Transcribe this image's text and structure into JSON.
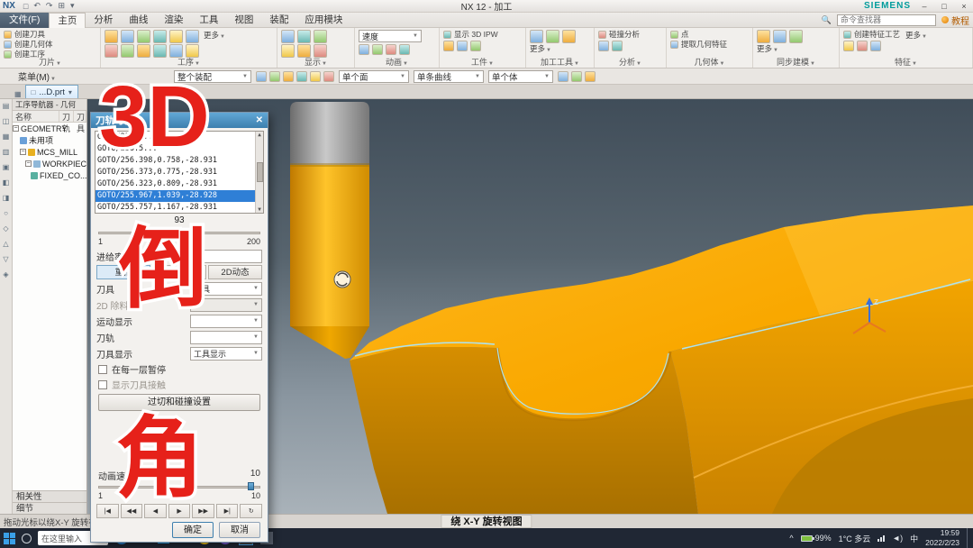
{
  "window": {
    "logo": "NX",
    "title": "NX 12 - 加工",
    "brand": "SIEMENS",
    "min": "–",
    "max": "□",
    "close": "×"
  },
  "menu": {
    "file": "文件(F)",
    "tabs": [
      "主页",
      "分析",
      "曲线",
      "渲染",
      "工具",
      "视图",
      "装配",
      "应用模块"
    ],
    "finder_placeholder": "命令查找器",
    "tutorial": "教程"
  },
  "ribbon": {
    "groups": [
      {
        "label": "刀片",
        "items": [
          "创建刀具",
          "创建几何体",
          "创建工序"
        ]
      },
      {
        "label": "工序",
        "more": "更多"
      },
      {
        "label": "显示"
      },
      {
        "label": "动画",
        "speed_label": "速度"
      },
      {
        "label": "工件",
        "ipw_label": "显示 3D IPW"
      },
      {
        "label": "加工工具",
        "more": "更多"
      },
      {
        "label": "分析",
        "item": "碰撞分析"
      },
      {
        "label": "几何体",
        "items": [
          "点",
          "提取几何特征"
        ]
      },
      {
        "label": "同步建模",
        "more": "更多"
      },
      {
        "label": "特征",
        "item": "创建特征工艺",
        "more": "更多"
      }
    ]
  },
  "selbar": {
    "menu_label": "菜单(M)",
    "scope_value": "整个装配",
    "filters": [
      "单个面",
      "单条曲线",
      "单个体"
    ]
  },
  "tabstrip": {
    "doc": "...D.prt"
  },
  "navigator": {
    "title": "工序导航器 - 几何",
    "columns": [
      "名称",
      "刀轨",
      "刀具"
    ],
    "tree": [
      {
        "label": "GEOMETRY"
      },
      {
        "label": "未用项"
      },
      {
        "label": "MCS_MILL"
      },
      {
        "label": "WORKPIECE"
      },
      {
        "label": "FIXED_CO..."
      }
    ],
    "sections": [
      "相关性",
      "细节"
    ]
  },
  "dialog": {
    "title": "刀轨可视化",
    "goto_lines": [
      "GOTO/256.6...",
      "GOTO/256.5...",
      "GOTO/256.398,0.758,-28.931",
      "GOTO/256.373,0.775,-28.931",
      "GOTO/256.323,0.809,-28.931",
      "GOTO/255.967,1.039,-28.928",
      "GOTO/255.757,1.167,-28.931"
    ],
    "progress": {
      "value": "93",
      "min": "1",
      "max": "200"
    },
    "feed_label": "进给率",
    "tabs": [
      "重播",
      "3D动态",
      "2D动态"
    ],
    "fields": [
      {
        "label": "刀具",
        "value": "刀具"
      },
      {
        "label": "2D 除料",
        "value": ""
      },
      {
        "label": "运动显示",
        "value": ""
      },
      {
        "label": "刀轨",
        "value": ""
      },
      {
        "label": "刀具显示",
        "value": "工具显示"
      }
    ],
    "checkbox1": "在每一层暂停",
    "checkbox2": "显示刀具接触",
    "gouge_button": "过切和碰撞设置",
    "anim": {
      "label": "动画速度",
      "value": "10",
      "min": "1",
      "max": "10"
    },
    "playback": [
      "|◀",
      "◀◀",
      "◀",
      "▶",
      "▶▶",
      "▶|",
      "↻"
    ],
    "ok": "确定",
    "cancel": "取消"
  },
  "viewport": {
    "rotate_label": "绕 X-Y 旋转视图"
  },
  "statusbar": {
    "prompt": "拖动光标以绕X-Y 旋转视图"
  },
  "taskbar": {
    "search_placeholder": "在这里输入",
    "nx": "NX",
    "tray": {
      "battery": "99%",
      "weather": "1°C 多云",
      "ime": "中",
      "time": "19:59",
      "date": "2022/2/23"
    }
  },
  "overlay": {
    "top": "3D",
    "mid": "倒",
    "bottom": "角"
  },
  "colors": {
    "accent": "#2f7fd6",
    "part_yellow": "#ffae00",
    "overlay_red": "#e6211a",
    "brand_teal": "#009c9c"
  }
}
